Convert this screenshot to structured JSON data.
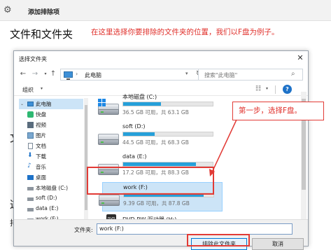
{
  "background": {
    "title": "添加排除项",
    "heading": "文件和文件夹",
    "note": "在这里选择你要排除的文件夹的位置，我们以F盘为例子。",
    "fragments": [
      "文",
      "这",
      "排"
    ]
  },
  "dialog": {
    "title": "选择文件夹",
    "close": "✕",
    "address": "此电脑",
    "search_placeholder": "搜索\"此电脑\"",
    "organize": "组织",
    "nav": [
      {
        "label": "此电脑",
        "icon": "pc-icon",
        "selected": true
      },
      {
        "label": "快盘",
        "icon": "cloud-icon"
      },
      {
        "label": "视频",
        "icon": "video-icon"
      },
      {
        "label": "图片",
        "icon": "picture-icon"
      },
      {
        "label": "文档",
        "icon": "document-icon"
      },
      {
        "label": "下载",
        "icon": "download-icon"
      },
      {
        "label": "音乐",
        "icon": "music-icon"
      },
      {
        "label": "桌面",
        "icon": "desktop-icon"
      },
      {
        "label": "本地磁盘 (C:)",
        "icon": "drive-icon"
      },
      {
        "label": "soft (D:)",
        "icon": "drive-icon"
      },
      {
        "label": "data (E:)",
        "icon": "drive-icon"
      },
      {
        "label": "work (F:)",
        "icon": "drive-icon"
      }
    ],
    "drives": [
      {
        "name": "本地磁盘 (C:)",
        "size": "36.5 GB 可用，共 63.1 GB",
        "used_fraction": 0.42,
        "system": true
      },
      {
        "name": "soft (D:)",
        "size": "44.5 GB 可用，共 68.3 GB",
        "used_fraction": 0.35
      },
      {
        "name": "data (E:)",
        "size": "17.2 GB 可用，共 88.3 GB",
        "used_fraction": 0.81
      },
      {
        "name": "work (F:)",
        "size": "9.39 GB 可用，共 87.8 GB",
        "used_fraction": 0.89,
        "selected": true
      },
      {
        "name": "DVD RW 驱动器 (H:)",
        "optical": true
      }
    ],
    "folder_label": "文件夹:",
    "folder_value": "work (F:)",
    "ok_button": "排除此文件夹",
    "cancel_button": "取消"
  },
  "callout": "第一步，选择F盘。",
  "colors": {
    "accent": "#26a0da",
    "annotation": "#e23b36",
    "selection": "#cce4f7"
  }
}
